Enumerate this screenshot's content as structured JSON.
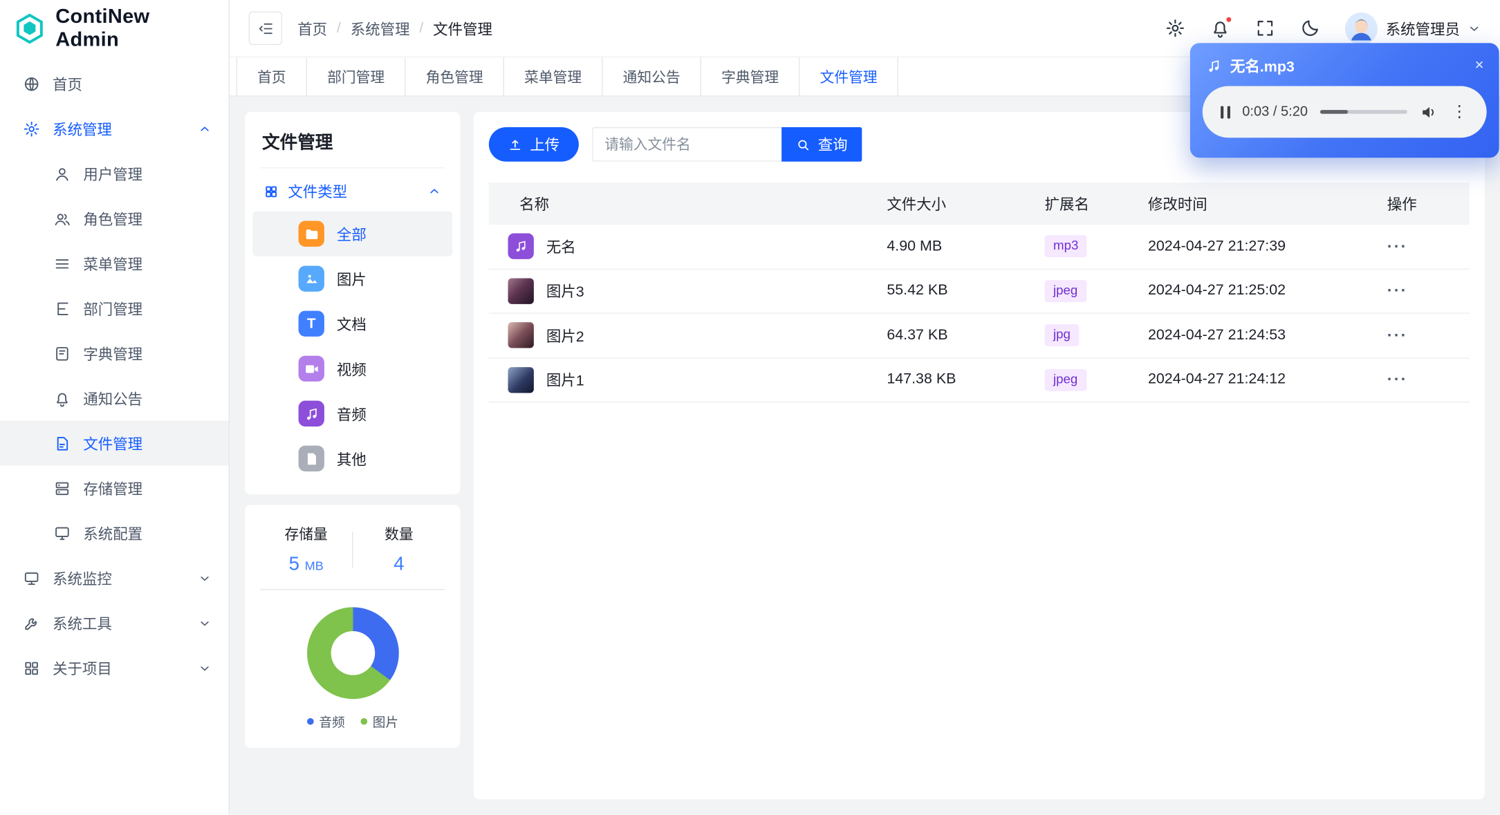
{
  "app": {
    "primary_color": "#165DFF"
  },
  "sidebar": {
    "logo_text": "ContiNew Admin",
    "home": "首页",
    "groups": {
      "system": {
        "label": "系统管理",
        "children": [
          "用户管理",
          "角色管理",
          "菜单管理",
          "部门管理",
          "字典管理",
          "通知公告",
          "文件管理",
          "存储管理",
          "系统配置"
        ]
      },
      "monitor": {
        "label": "系统监控"
      },
      "tools": {
        "label": "系统工具"
      },
      "about": {
        "label": "关于项目"
      }
    },
    "active_item": "文件管理"
  },
  "header": {
    "breadcrumb": [
      "首页",
      "系统管理",
      "文件管理"
    ],
    "breadcrumb_separator": "/",
    "username": "系统管理员"
  },
  "tabs": {
    "items": [
      "首页",
      "部门管理",
      "角色管理",
      "菜单管理",
      "通知公告",
      "字典管理",
      "文件管理"
    ],
    "active": "文件管理"
  },
  "file_panel": {
    "title": "文件管理",
    "type_group_label": "文件类型",
    "types": [
      {
        "label": "全部",
        "icon": "folder-icon"
      },
      {
        "label": "图片",
        "icon": "image-icon"
      },
      {
        "label": "文档",
        "icon": "document-icon"
      },
      {
        "label": "视频",
        "icon": "video-icon"
      },
      {
        "label": "音频",
        "icon": "audio-icon"
      },
      {
        "label": "其他",
        "icon": "file-icon"
      }
    ]
  },
  "stats": {
    "storage_label": "存储量",
    "storage_value": "5",
    "storage_unit": "MB",
    "count_label": "数量",
    "count_value": "4"
  },
  "chart_data": {
    "type": "pie",
    "donut": true,
    "labels": [
      "音频",
      "图片"
    ],
    "values": [
      35,
      65
    ],
    "unit": "percent (estimated from arc angles)",
    "colors": [
      "#3e6cf0",
      "#7fc24c"
    ],
    "legend_position": "bottom"
  },
  "toolbar": {
    "upload": "上传",
    "search_placeholder": "请输入文件名",
    "query": "查询"
  },
  "table": {
    "columns": [
      "名称",
      "文件大小",
      "扩展名",
      "修改时间",
      "操作"
    ],
    "rows": [
      {
        "name": "无名",
        "size": "4.90 MB",
        "ext": "mp3",
        "modified": "2024-04-27 21:27:39",
        "icon": "audio-file"
      },
      {
        "name": "图片3",
        "size": "55.42 KB",
        "ext": "jpeg",
        "modified": "2024-04-27 21:25:02",
        "icon": "image-thumbnail"
      },
      {
        "name": "图片2",
        "size": "64.37 KB",
        "ext": "jpg",
        "modified": "2024-04-27 21:24:53",
        "icon": "image-thumbnail"
      },
      {
        "name": "图片1",
        "size": "147.38 KB",
        "ext": "jpeg",
        "modified": "2024-04-27 21:24:12",
        "icon": "image-thumbnail"
      }
    ]
  },
  "audio_player": {
    "title": "无名.mp3",
    "time": "0:03 / 5:20"
  },
  "icons": {
    "close": "×",
    "kebab": "⋮",
    "row_actions": "···",
    "document_glyph": "T"
  }
}
